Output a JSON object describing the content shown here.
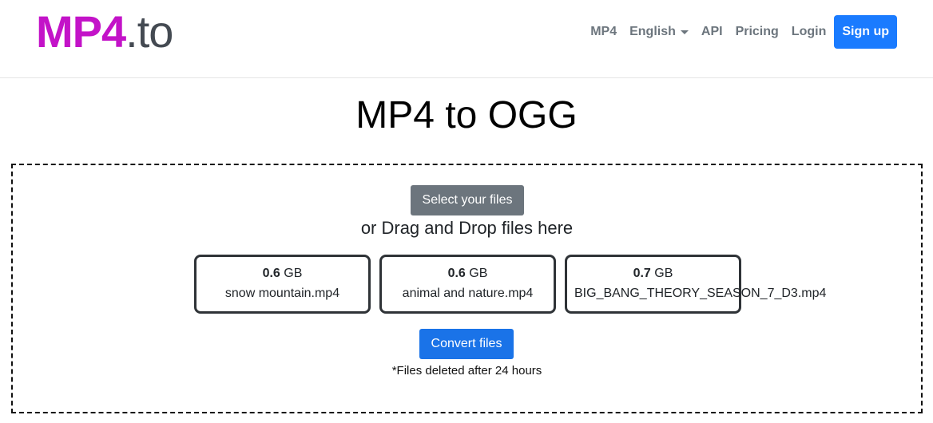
{
  "logo": {
    "part1": "MP4",
    "part2": ".to"
  },
  "nav": {
    "items": [
      "MP4",
      "English",
      "API",
      "Pricing",
      "Login"
    ],
    "signup": "Sign up"
  },
  "page": {
    "title": "MP4 to OGG"
  },
  "upload": {
    "select_button": "Select your files",
    "drag_text": "or Drag and Drop files here",
    "files": [
      {
        "size_value": "0.6",
        "size_unit": "GB",
        "name": "snow mountain.mp4"
      },
      {
        "size_value": "0.6",
        "size_unit": "GB",
        "name": "animal and nature.mp4"
      },
      {
        "size_value": "0.7",
        "size_unit": "GB",
        "name": "BIG_BANG_THEORY_SEASON_7_D3.mp4"
      }
    ],
    "convert_button": "Convert files",
    "note": "*Files deleted after 24 hours"
  },
  "colors": {
    "brand": "#c313c8",
    "primary": "#1a7bff",
    "secondary": "#6c757d"
  }
}
